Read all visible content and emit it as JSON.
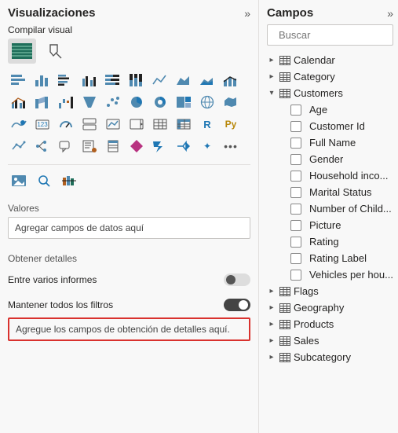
{
  "viz": {
    "title": "Visualizaciones",
    "subtitle": "Compilar visual",
    "values_label": "Valores",
    "values_placeholder": "Agregar campos de datos aquí",
    "drill_label": "Obtener detalles",
    "cross_report_label": "Entre varios informes",
    "keep_filters_label": "Mantener todos los filtros",
    "drill_placeholder": "Agregue los campos de obtención de detalles aquí."
  },
  "fields": {
    "title": "Campos",
    "search_placeholder": "Buscar",
    "tables": [
      {
        "name": "Calendar",
        "expanded": false
      },
      {
        "name": "Category",
        "expanded": false
      },
      {
        "name": "Customers",
        "expanded": true,
        "fields": [
          "Age",
          "Customer Id",
          "Full Name",
          "Gender",
          "Household inco...",
          "Marital Status",
          "Number of Child...",
          "Picture",
          "Rating",
          "Rating Label",
          "Vehicles per hou..."
        ]
      },
      {
        "name": "Flags",
        "expanded": false
      },
      {
        "name": "Geography",
        "expanded": false
      },
      {
        "name": "Products",
        "expanded": false
      },
      {
        "name": "Sales",
        "expanded": false
      },
      {
        "name": "Subcategory",
        "expanded": false
      }
    ]
  },
  "viz_items": [
    "stacked-bar",
    "stacked-column",
    "clustered-bar",
    "clustered-column",
    "100-stacked-bar",
    "100-stacked-column",
    "line",
    "area",
    "stacked-area",
    "line-stacked-column",
    "line-clustered-column",
    "ribbon",
    "waterfall",
    "funnel",
    "scatter",
    "pie",
    "donut",
    "treemap",
    "map",
    "filled-map",
    "azure-map",
    "gauge",
    "card",
    "multi-row-card",
    "kpi",
    "slicer",
    "table",
    "matrix",
    "r",
    "python",
    "key-influencers",
    "decomposition",
    "qna",
    "qa",
    "narrative",
    "paginated",
    "power-apps",
    "power-automate",
    "sparkle",
    "more"
  ]
}
